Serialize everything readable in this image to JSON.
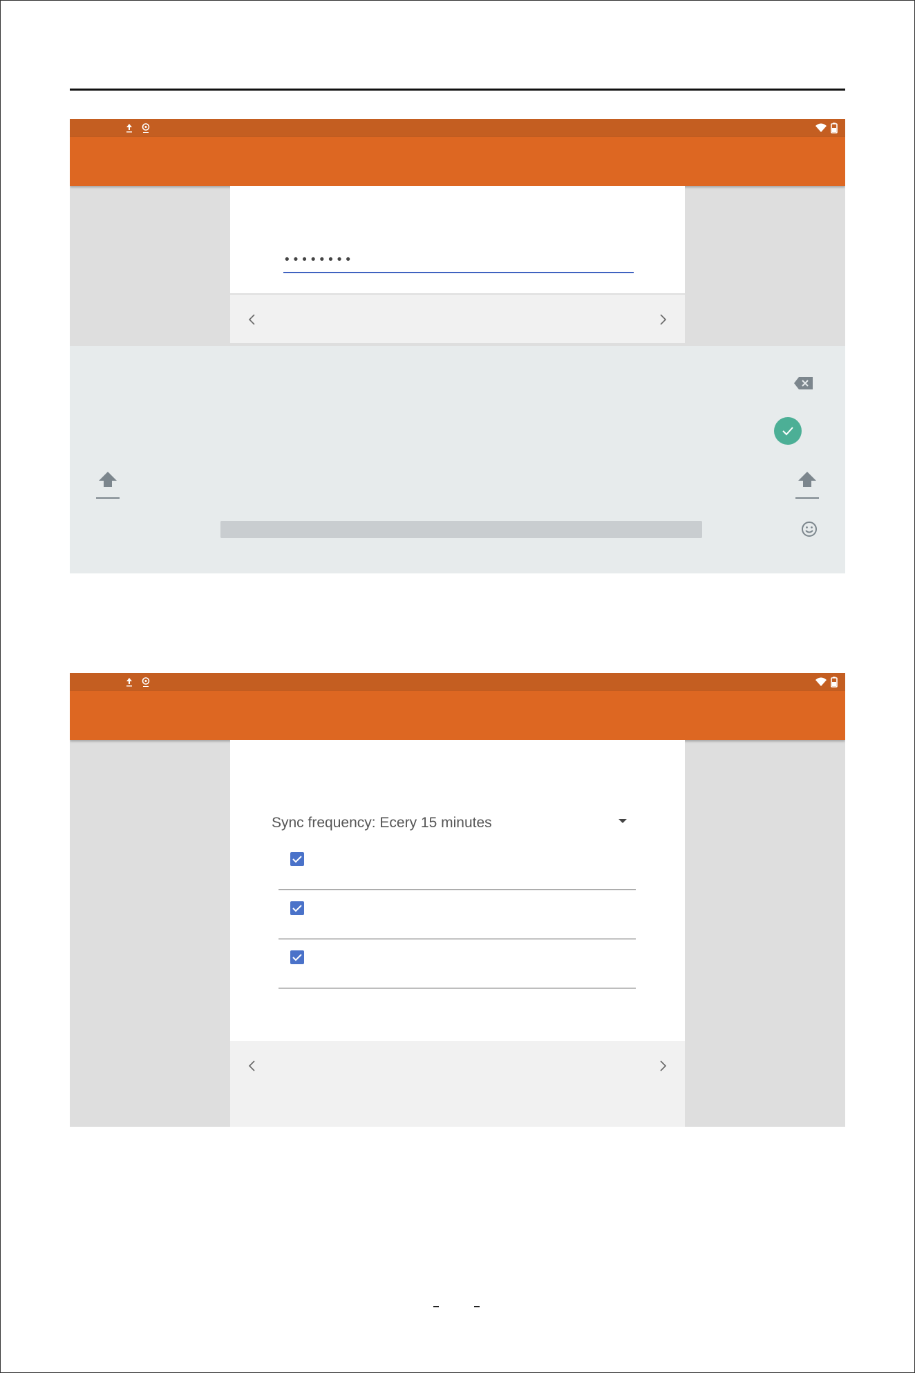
{
  "screens": [
    {
      "id": "password-screen",
      "status_icons_left": [
        "upload-icon",
        "location-pin-icon"
      ],
      "status_icons_right": [
        "wifi-icon",
        "battery-icon"
      ],
      "password": {
        "masked_value": "••••••••"
      },
      "nav": {
        "prev_icon": "chevron-left-icon",
        "next_icon": "chevron-right-icon"
      },
      "keyboard": {
        "icons": [
          "backspace-icon",
          "done-check-icon",
          "shift-icon",
          "shift-icon",
          "emoji-icon"
        ]
      }
    },
    {
      "id": "sync-screen",
      "status_icons_left": [
        "upload-icon",
        "location-pin-icon"
      ],
      "status_icons_right": [
        "wifi-icon",
        "battery-icon"
      ],
      "sync": {
        "frequency_label": "Sync frequency: Ecery 15 minutes",
        "checkboxes": [
          {
            "checked": true,
            "label": ""
          },
          {
            "checked": true,
            "label": ""
          },
          {
            "checked": true,
            "label": ""
          }
        ]
      },
      "nav": {
        "prev_icon": "chevron-left-icon",
        "next_icon": "chevron-right-icon"
      }
    }
  ],
  "colors": {
    "status_bar": "#c45e21",
    "toolbar": "#dd6722",
    "accent_blue": "#3f62c0",
    "done_button": "#4caf96",
    "checkbox": "#4a72c9"
  }
}
